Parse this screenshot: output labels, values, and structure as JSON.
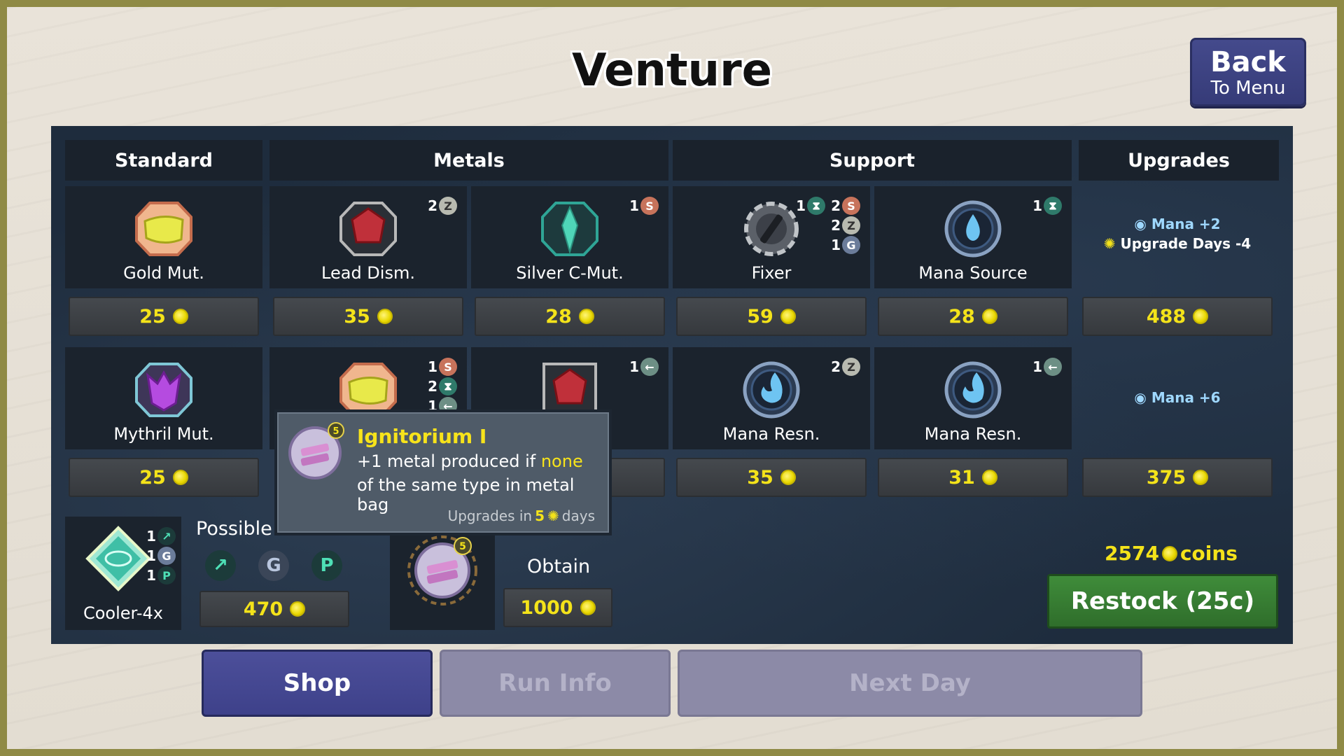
{
  "title": "Venture",
  "back_button": {
    "line1": "Back",
    "line2": "To Menu"
  },
  "columns": [
    "Standard",
    "Metals",
    "Support",
    "Upgrades"
  ],
  "row1": [
    {
      "name": "Gold Mut.",
      "price": "25",
      "icon": "gold-gem-icon",
      "badges": []
    },
    {
      "name": "Lead Dism.",
      "price": "35",
      "icon": "ruby-gem-icon",
      "badges": [
        {
          "count": "2",
          "icon": "z-rune-icon",
          "color": "#b8bab0"
        }
      ]
    },
    {
      "name": "Silver C-Mut.",
      "price": "28",
      "icon": "crystal-icon",
      "badges": [
        {
          "count": "1",
          "icon": "s-rune-icon",
          "color": "#c7735b"
        }
      ]
    },
    {
      "name": "Fixer",
      "price": "59",
      "icon": "gear-wrench-icon",
      "badges": [
        {
          "count": "1",
          "icon": "hourglass-icon",
          "color": "#2f7a6a"
        },
        {
          "count": "2",
          "icon": "s-rune-icon",
          "color": "#c7735b"
        },
        {
          "count": "2",
          "icon": "z-rune-icon",
          "color": "#b8bab0"
        },
        {
          "count": "1",
          "icon": "g-rune-icon",
          "color": "#6b7c9a"
        }
      ]
    },
    {
      "name": "Mana Source",
      "price": "28",
      "icon": "mana-drop-icon",
      "badges": [
        {
          "count": "1",
          "icon": "hourglass-icon",
          "color": "#2f7a6a"
        }
      ]
    }
  ],
  "row2": [
    {
      "name": "Mythril Mut.",
      "price": "25",
      "icon": "mythril-gem-icon",
      "badges": []
    },
    {
      "name": "",
      "price": "",
      "icon": "gold-gem-icon",
      "badges": [
        {
          "count": "1",
          "icon": "s-rune-icon",
          "color": "#c7735b"
        },
        {
          "count": "2",
          "icon": "hourglass-icon",
          "color": "#2f7a6a"
        },
        {
          "count": "1",
          "icon": "arrow-rune-icon",
          "color": "#6d8f85"
        }
      ]
    },
    {
      "name": "",
      "price": "",
      "icon": "ruby-gem-icon",
      "badges": [
        {
          "count": "1",
          "icon": "arrow-rune-icon",
          "color": "#6d8f85"
        }
      ]
    },
    {
      "name": "Mana Resn.",
      "price": "35",
      "icon": "mana-flame-icon",
      "badges": [
        {
          "count": "2",
          "icon": "z-rune-icon",
          "color": "#b8bab0"
        }
      ]
    },
    {
      "name": "Mana Resn.",
      "price": "31",
      "icon": "mana-flame-icon",
      "badges": [
        {
          "count": "1",
          "icon": "arrow-rune-icon",
          "color": "#6d8f85"
        }
      ]
    }
  ],
  "upgrades": [
    {
      "line1": "Mana +2",
      "line2": "Upgrade Days -4",
      "price": "488"
    },
    {
      "line1": "Mana +6",
      "price": "375"
    }
  ],
  "cooler": {
    "name": "Cooler-4x",
    "badges": [
      "1",
      "1",
      "1"
    ]
  },
  "possible": {
    "label": "Possible",
    "price": "470"
  },
  "obtain": {
    "label": "Obtain",
    "price": "1000"
  },
  "tooltip": {
    "title": "Ignitorium I",
    "line1_pre": "+1 metal produced if ",
    "line1_hl": "none",
    "line2": "of the same type in metal bag",
    "footer_pre": "Upgrades in ",
    "footer_num": "5",
    "footer_post": "days",
    "level": "5"
  },
  "coins_total": {
    "value": "2574",
    "unit": "coins"
  },
  "restock": "Restock (25c)",
  "tabs": {
    "shop": "Shop",
    "run_info": "Run Info",
    "next_day": "Next Day"
  }
}
